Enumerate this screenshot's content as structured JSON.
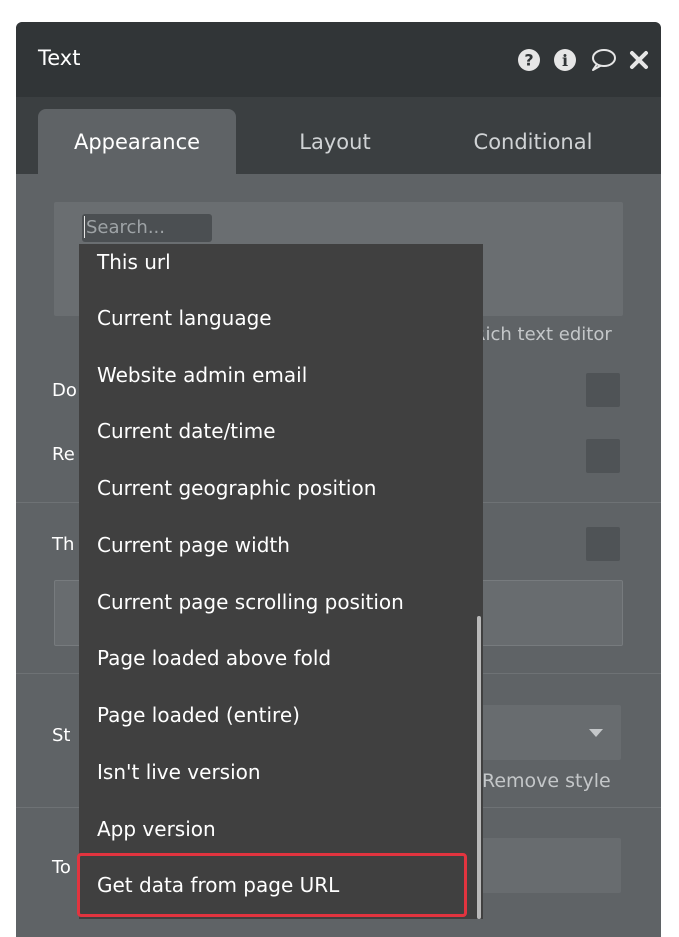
{
  "header": {
    "title": "Text",
    "icons": [
      "help-icon",
      "info-icon",
      "comment-icon",
      "close-icon"
    ]
  },
  "tabs": [
    {
      "label": "Appearance",
      "active": true
    },
    {
      "label": "Layout",
      "active": false
    },
    {
      "label": "Conditional",
      "active": false
    }
  ],
  "editor": {
    "search_placeholder": "Search...",
    "rich_text_label": "Rich text editor"
  },
  "rows": {
    "row1_partial": "Do",
    "row2_partial": "Re",
    "row3_partial": "Th",
    "style_partial": "St",
    "row5_partial": "To"
  },
  "style": {
    "remove_label": "Remove style"
  },
  "dropdown": {
    "items": [
      "This url",
      "Current language",
      "Website admin email",
      "Current date/time",
      "Current geographic position",
      "Current page width",
      "Current page scrolling position",
      "Page loaded above fold",
      "Page loaded (entire)",
      "Isn't live version",
      "App version",
      "Get data from page URL"
    ],
    "highlighted_index": 11
  },
  "colors": {
    "header_bg": "#313537",
    "panel_bg": "#5f6366",
    "dropdown_bg": "#404040",
    "highlight": "#e2343f"
  }
}
